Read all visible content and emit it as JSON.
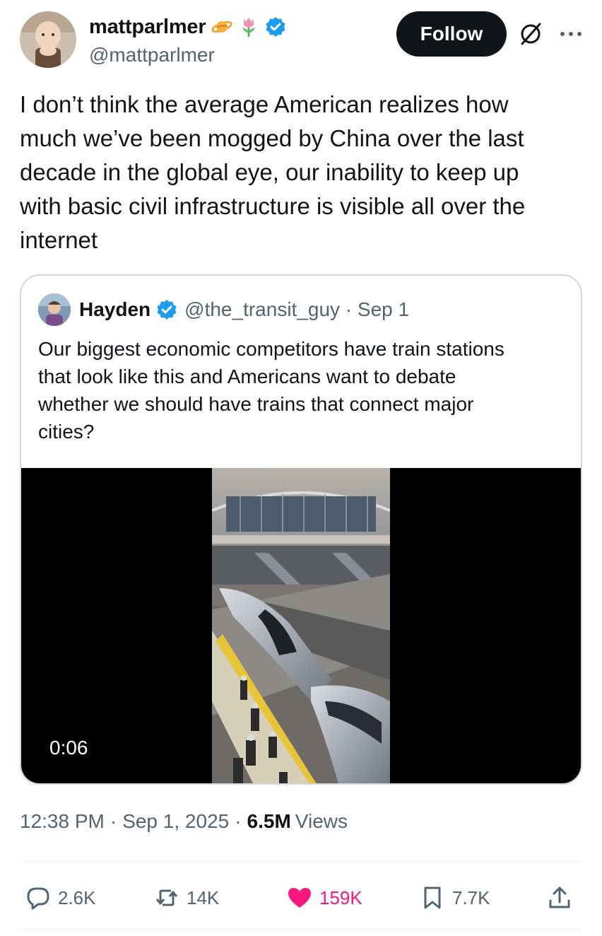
{
  "author": {
    "display_name": "mattparlmer",
    "handle": "@mattparlmer",
    "badges": [
      "ringed-planet-emoji",
      "tulip-emoji",
      "verified-badge"
    ]
  },
  "follow_button": {
    "label": "Follow"
  },
  "icons": {
    "grok": "grok-icon",
    "more": "more-options-icon"
  },
  "tweet": {
    "text": "I don’t think the average American realizes how\nmuch we’ve been mogged by China over the last\ndecade in the global eye, our inability to keep up\nwith basic civil infrastructure is visible all over the\ninternet"
  },
  "quoted_tweet": {
    "display_name": "Hayden",
    "handle_date": "@the_transit_guy · Sep 1",
    "text": "Our biggest economic competitors have train stations\nthat look like this and Americans want to debate\nwhether we should have trains that connect major\ncities?",
    "video": {
      "duration": "0:06"
    }
  },
  "meta": {
    "time": "12:38 PM",
    "sep": "·",
    "date": "Sep 1, 2025",
    "views_count": "6.5M",
    "views_label": "Views"
  },
  "actions": {
    "replies": "2.6K",
    "reposts": "14K",
    "likes": "159K",
    "bookmarks": "7.7K"
  },
  "colors": {
    "text": "#0f1419",
    "secondary": "#536471",
    "verified": "#1d9bf0",
    "like": "#f91880",
    "border": "#cfd9de"
  }
}
